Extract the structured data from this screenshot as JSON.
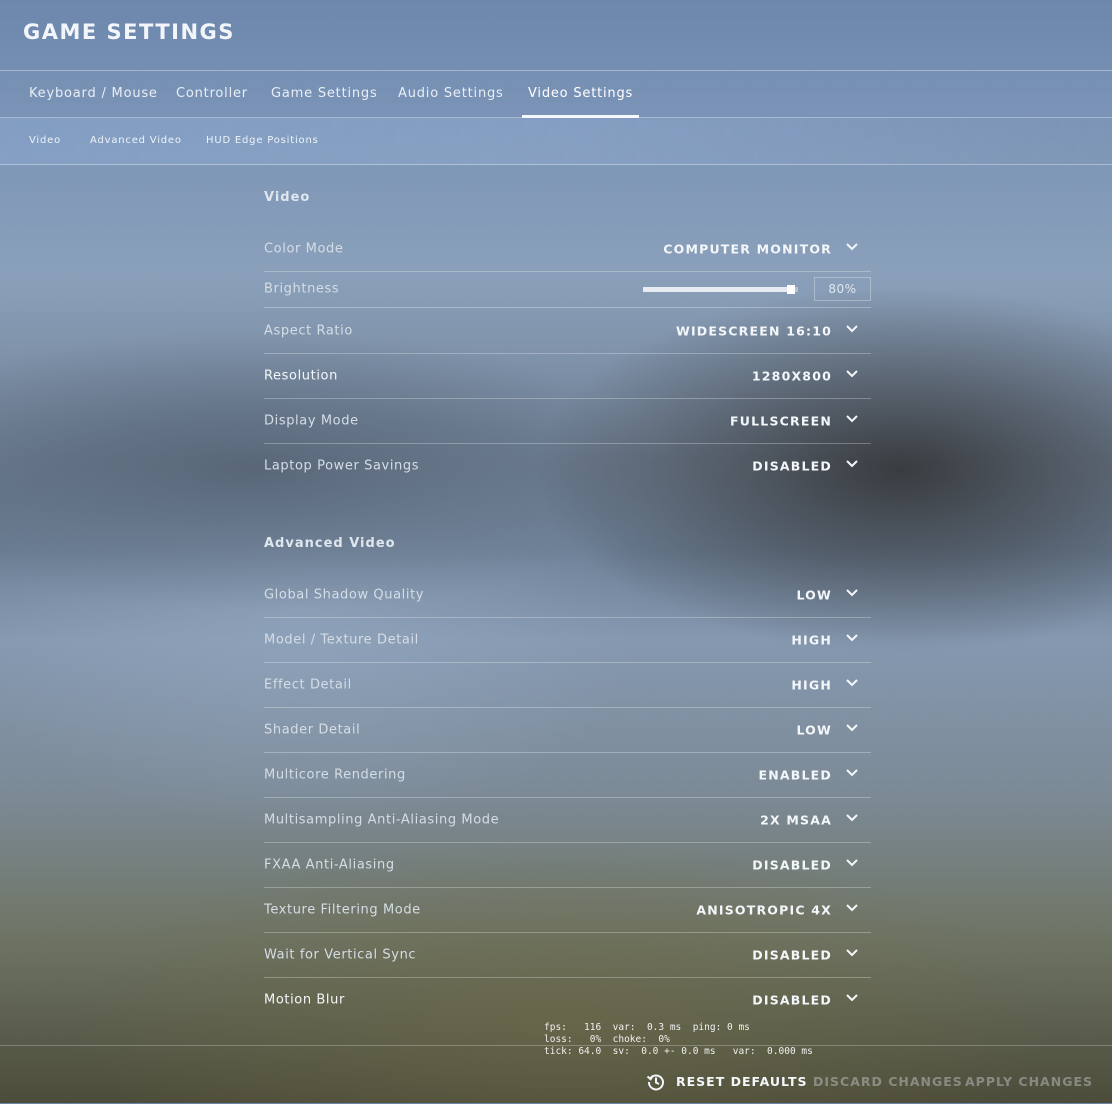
{
  "header": {
    "title": "GAME SETTINGS"
  },
  "tabs": [
    {
      "label": "Keyboard / Mouse"
    },
    {
      "label": "Controller"
    },
    {
      "label": "Game Settings"
    },
    {
      "label": "Audio Settings"
    },
    {
      "label": "Video Settings",
      "active": true
    }
  ],
  "subtabs": [
    {
      "label": "Video"
    },
    {
      "label": "Advanced Video"
    },
    {
      "label": "HUD Edge Positions"
    }
  ],
  "video": {
    "title": "Video",
    "color_mode": {
      "label": "Color Mode",
      "value": "COMPUTER MONITOR"
    },
    "brightness": {
      "label": "Brightness",
      "value": 0.8,
      "display": "80%"
    },
    "aspect_ratio": {
      "label": "Aspect Ratio",
      "value": "WIDESCREEN 16:10"
    },
    "resolution": {
      "label": "Resolution",
      "value": "1280X800"
    },
    "display_mode": {
      "label": "Display Mode",
      "value": "FULLSCREEN"
    },
    "laptop_power": {
      "label": "Laptop Power Savings",
      "value": "DISABLED"
    }
  },
  "advanced": {
    "title": "Advanced Video",
    "rows": [
      {
        "label": "Global Shadow Quality",
        "value": "LOW"
      },
      {
        "label": "Model / Texture Detail",
        "value": "HIGH"
      },
      {
        "label": "Effect Detail",
        "value": "HIGH"
      },
      {
        "label": "Shader Detail",
        "value": "LOW"
      },
      {
        "label": "Multicore Rendering",
        "value": "ENABLED"
      },
      {
        "label": "Multisampling Anti-Aliasing Mode",
        "value": "2X MSAA"
      },
      {
        "label": "FXAA Anti-Aliasing",
        "value": "DISABLED"
      },
      {
        "label": "Texture Filtering Mode",
        "value": "ANISOTROPIC 4X"
      },
      {
        "label": "Wait for Vertical Sync",
        "value": "DISABLED"
      },
      {
        "label": "Motion Blur",
        "value": "DISABLED"
      }
    ]
  },
  "netgraph": {
    "line1": "fps:   116  var:  0.3 ms  ping: 0 ms",
    "line2": "loss:   0%  choke:  0%",
    "line3": "tick: 64.0  sv:  0.0 +- 0.0 ms   var:  0.000 ms"
  },
  "footer": {
    "reset": "RESET DEFAULTS",
    "discard": "DISCARD CHANGES",
    "apply": "APPLY CHANGES"
  },
  "icons": {
    "dropdown": "chevron-down-icon",
    "reset": "history-icon"
  }
}
